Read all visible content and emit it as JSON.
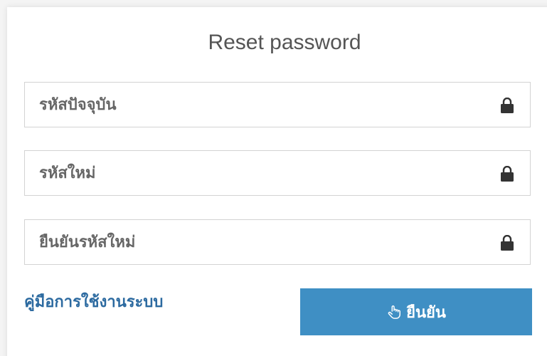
{
  "form": {
    "title": "Reset password",
    "fields": [
      {
        "placeholder": "รหัสปัจจุบัน",
        "icon": "lock-icon"
      },
      {
        "placeholder": "รหัสใหม่",
        "icon": "lock-icon"
      },
      {
        "placeholder": "ยืนยันรหัสใหม่",
        "icon": "lock-icon"
      }
    ],
    "guide_link": "คู่มือการใช้งานระบบ",
    "confirm_label": "ยืนยัน",
    "confirm_icon": "hand-pointer-icon"
  },
  "colors": {
    "accent": "#3f8fc4",
    "link": "#2c6aa0",
    "title": "#555555",
    "border": "#d3d3d3"
  }
}
